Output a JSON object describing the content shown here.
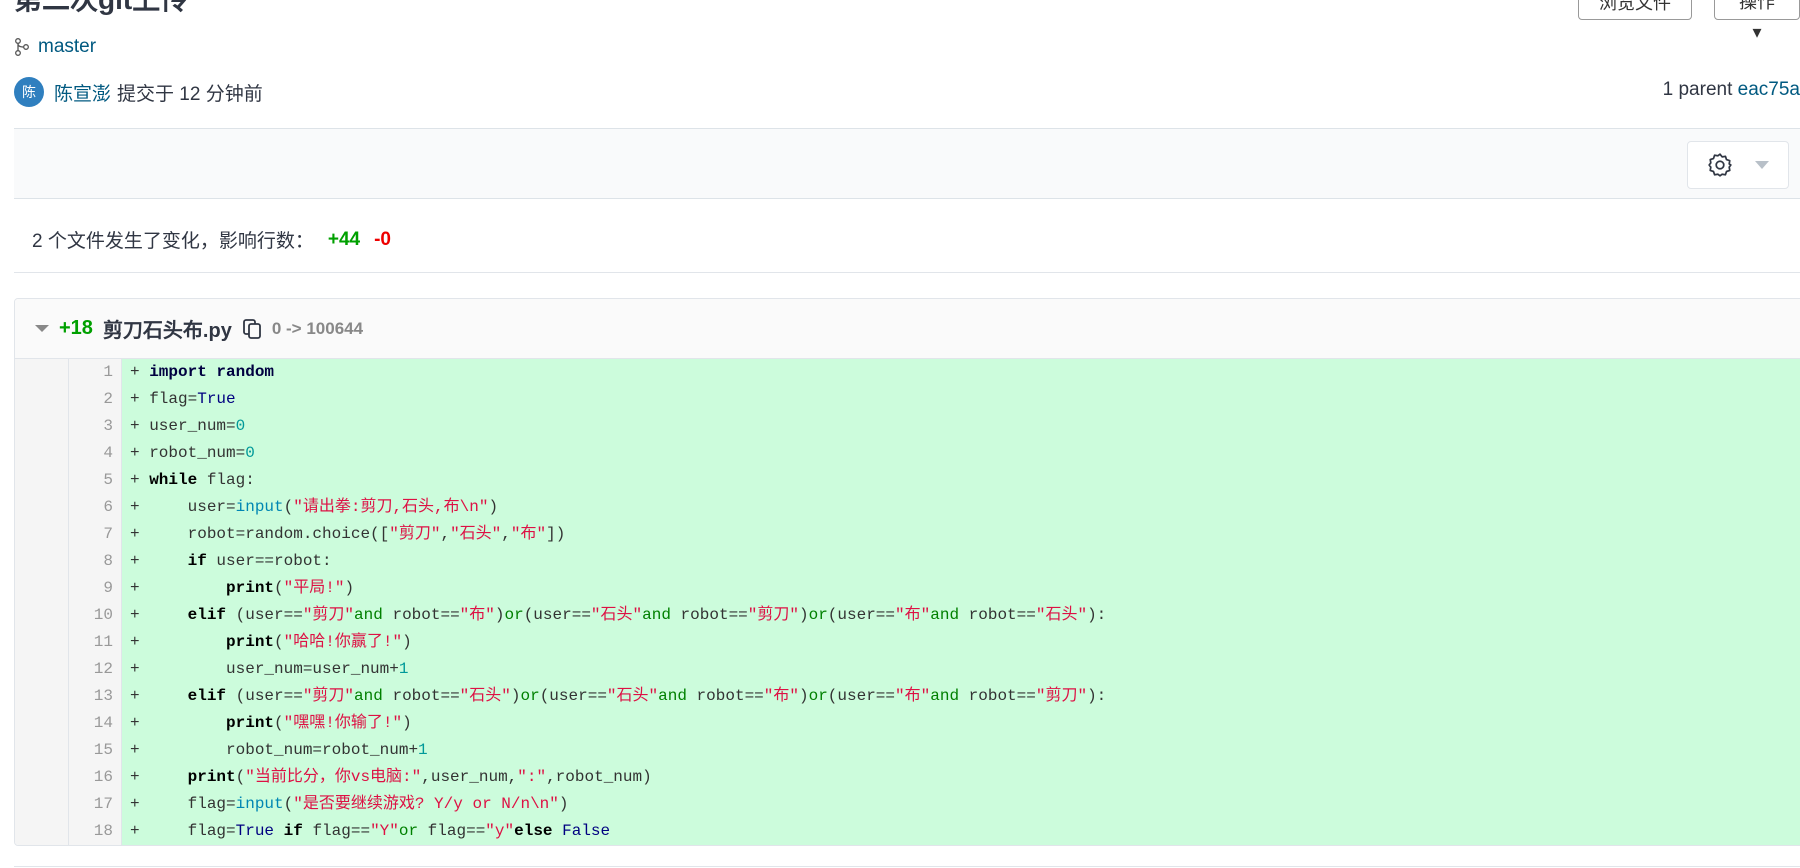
{
  "header": {
    "title": "第二次git上传",
    "browse_label": "浏览文件",
    "actions_label": "操作 ▾"
  },
  "commit": {
    "branch": "master",
    "avatar_letter": "陈",
    "author": "陈宣澎",
    "committed": "提交于 12 分钟前",
    "parent_count": "1 parent",
    "parent_sha": "eac75a"
  },
  "summary": {
    "text": "2 个文件发生了变化，影响行数：",
    "additions": "+44",
    "deletions": "-0"
  },
  "file": {
    "additions": "+18",
    "name": "剪刀石头布.py",
    "mode": "0 -> 100644",
    "lines": [
      [
        [
          "imp",
          "import random"
        ]
      ],
      [
        [
          "t",
          "flag="
        ],
        [
          "c",
          "True"
        ]
      ],
      [
        [
          "t",
          "user_num="
        ],
        [
          "n",
          "0"
        ]
      ],
      [
        [
          "t",
          "robot_num="
        ],
        [
          "n",
          "0"
        ]
      ],
      [
        [
          "k",
          "while"
        ],
        [
          "t",
          " flag:"
        ]
      ],
      [
        [
          "t",
          "    user="
        ],
        [
          "b",
          "input"
        ],
        [
          "t",
          "("
        ],
        [
          "s",
          "\"请出拳:剪刀,石头,布\\n\""
        ],
        [
          "t",
          ")"
        ]
      ],
      [
        [
          "t",
          "    robot=random.choice(["
        ],
        [
          "s",
          "\"剪刀\""
        ],
        [
          "t",
          ","
        ],
        [
          "s",
          "\"石头\""
        ],
        [
          "t",
          ","
        ],
        [
          "s",
          "\"布\""
        ],
        [
          "t",
          "])"
        ]
      ],
      [
        [
          "t",
          "    "
        ],
        [
          "k",
          "if"
        ],
        [
          "t",
          " user==robot:"
        ]
      ],
      [
        [
          "t",
          "        "
        ],
        [
          "k",
          "print"
        ],
        [
          "t",
          "("
        ],
        [
          "s",
          "\"平局!\""
        ],
        [
          "t",
          ")"
        ]
      ],
      [
        [
          "t",
          "    "
        ],
        [
          "k",
          "elif"
        ],
        [
          "t",
          " (user=="
        ],
        [
          "s",
          "\"剪刀\""
        ],
        [
          "o",
          "and"
        ],
        [
          "t",
          " robot=="
        ],
        [
          "s",
          "\"布\""
        ],
        [
          "t",
          ")"
        ],
        [
          "o",
          "or"
        ],
        [
          "t",
          "(user=="
        ],
        [
          "s",
          "\"石头\""
        ],
        [
          "o",
          "and"
        ],
        [
          "t",
          " robot=="
        ],
        [
          "s",
          "\"剪刀\""
        ],
        [
          "t",
          ")"
        ],
        [
          "o",
          "or"
        ],
        [
          "t",
          "(user=="
        ],
        [
          "s",
          "\"布\""
        ],
        [
          "o",
          "and"
        ],
        [
          "t",
          " robot=="
        ],
        [
          "s",
          "\"石头\""
        ],
        [
          "t",
          "):"
        ]
      ],
      [
        [
          "t",
          "        "
        ],
        [
          "k",
          "print"
        ],
        [
          "t",
          "("
        ],
        [
          "s",
          "\"哈哈!你赢了!\""
        ],
        [
          "t",
          ")"
        ]
      ],
      [
        [
          "t",
          "        user_num=user_num+"
        ],
        [
          "n",
          "1"
        ]
      ],
      [
        [
          "t",
          "    "
        ],
        [
          "k",
          "elif"
        ],
        [
          "t",
          " (user=="
        ],
        [
          "s",
          "\"剪刀\""
        ],
        [
          "o",
          "and"
        ],
        [
          "t",
          " robot=="
        ],
        [
          "s",
          "\"石头\""
        ],
        [
          "t",
          ")"
        ],
        [
          "o",
          "or"
        ],
        [
          "t",
          "(user=="
        ],
        [
          "s",
          "\"石头\""
        ],
        [
          "o",
          "and"
        ],
        [
          "t",
          " robot=="
        ],
        [
          "s",
          "\"布\""
        ],
        [
          "t",
          ")"
        ],
        [
          "o",
          "or"
        ],
        [
          "t",
          "(user=="
        ],
        [
          "s",
          "\"布\""
        ],
        [
          "o",
          "and"
        ],
        [
          "t",
          " robot=="
        ],
        [
          "s",
          "\"剪刀\""
        ],
        [
          "t",
          "):"
        ]
      ],
      [
        [
          "t",
          "        "
        ],
        [
          "k",
          "print"
        ],
        [
          "t",
          "("
        ],
        [
          "s",
          "\"嘿嘿!你输了!\""
        ],
        [
          "t",
          ")"
        ]
      ],
      [
        [
          "t",
          "        robot_num=robot_num+"
        ],
        [
          "n",
          "1"
        ]
      ],
      [
        [
          "t",
          "    "
        ],
        [
          "k",
          "print"
        ],
        [
          "t",
          "("
        ],
        [
          "s",
          "\"当前比分，你vs电脑:\""
        ],
        [
          "t",
          ",user_num,"
        ],
        [
          "s",
          "\":\""
        ],
        [
          "t",
          ",robot_num)"
        ]
      ],
      [
        [
          "t",
          "    flag="
        ],
        [
          "b",
          "input"
        ],
        [
          "t",
          "("
        ],
        [
          "s",
          "\"是否要继续游戏? Y/y or N/n\\n\""
        ],
        [
          "t",
          ")"
        ]
      ],
      [
        [
          "t",
          "    flag="
        ],
        [
          "c",
          "True"
        ],
        [
          "t",
          " "
        ],
        [
          "k",
          "if"
        ],
        [
          "t",
          " flag=="
        ],
        [
          "s",
          "\"Y\""
        ],
        [
          "o",
          "or"
        ],
        [
          "t",
          " flag=="
        ],
        [
          "s",
          "\"y\""
        ],
        [
          "k",
          "else"
        ],
        [
          "t",
          " "
        ],
        [
          "c",
          "False"
        ]
      ]
    ]
  }
}
